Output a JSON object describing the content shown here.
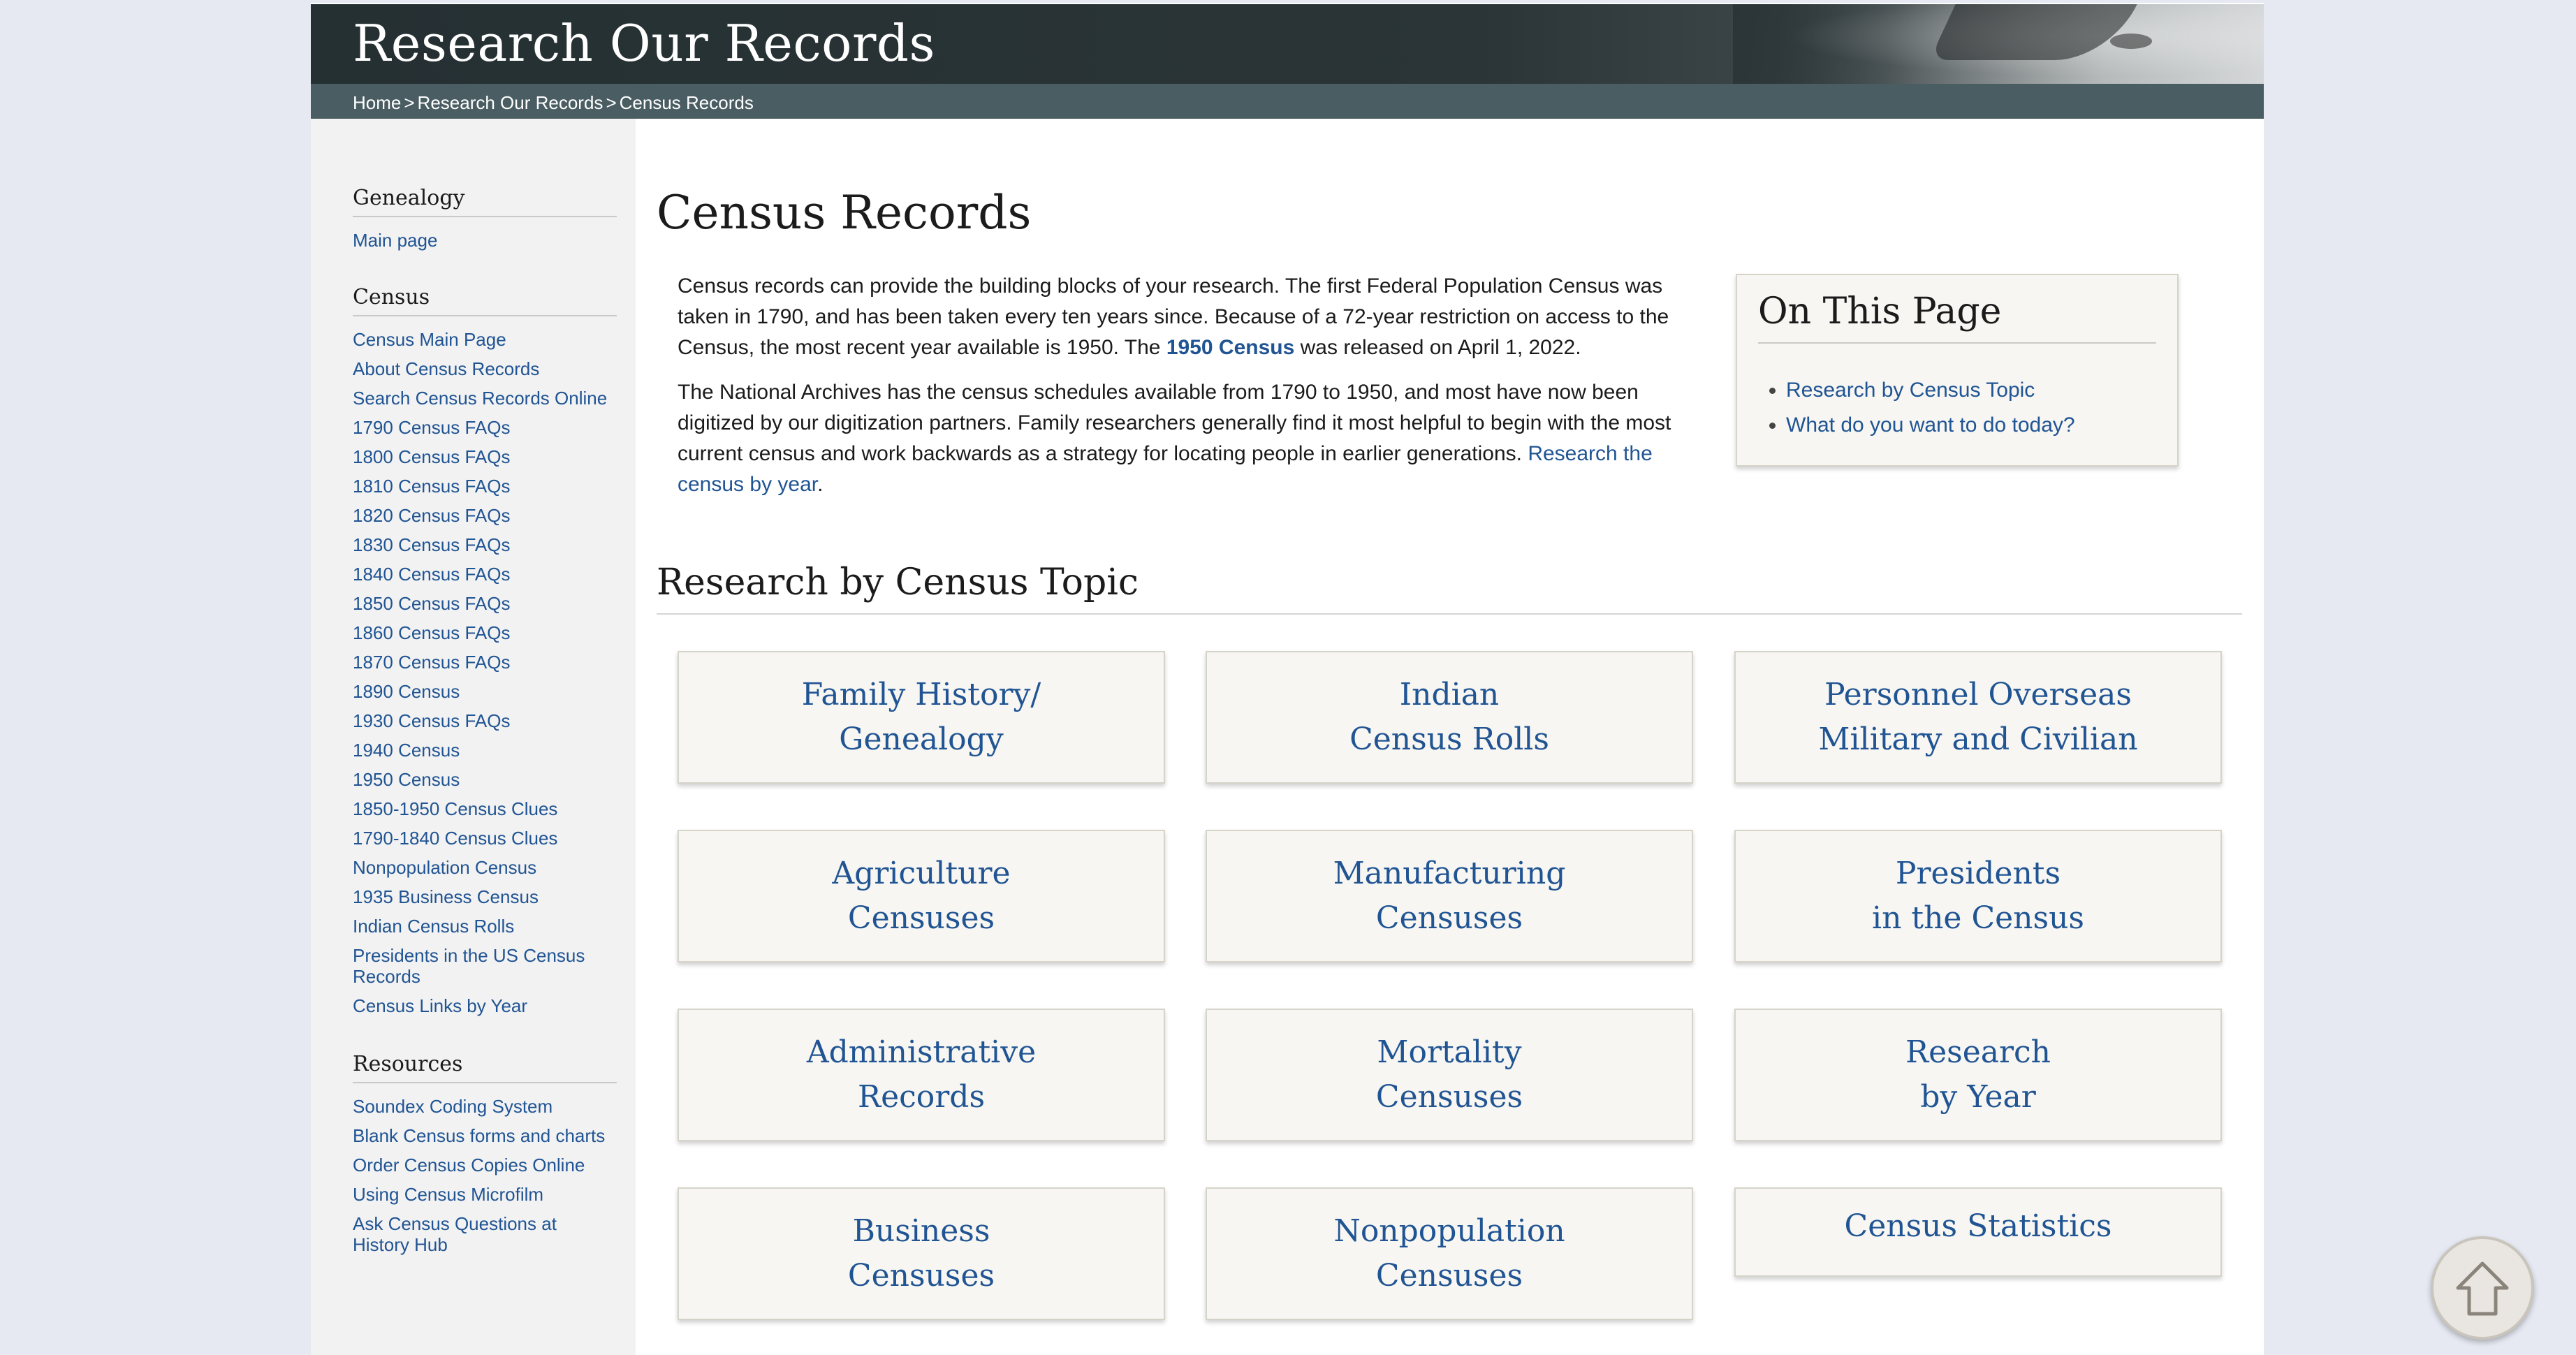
{
  "header": {
    "title": "Research Our Records",
    "breadcrumb": [
      "Home",
      "Research Our Records",
      "Census Records"
    ],
    "breadcrumb_separator": ">"
  },
  "sidebar": {
    "groups": [
      {
        "heading": "Genealogy",
        "items": [
          "Main page"
        ]
      },
      {
        "heading": "Census",
        "items": [
          "Census Main Page",
          "About Census Records",
          "Search Census Records Online",
          "1790 Census FAQs",
          "1800 Census FAQs",
          "1810 Census FAQs",
          "1820 Census FAQs",
          "1830 Census FAQs",
          "1840 Census FAQs",
          "1850 Census FAQs",
          "1860 Census FAQs",
          "1870 Census FAQs",
          "1890 Census",
          "1930 Census FAQs",
          "1940 Census",
          "1950 Census",
          "1850-1950 Census Clues",
          "1790-1840 Census Clues",
          "Nonpopulation Census",
          "1935 Business Census",
          "Indian Census Rolls",
          "Presidents in the US Census Records",
          "Census Links by Year"
        ]
      },
      {
        "heading": "Resources",
        "items": [
          "Soundex Coding System",
          "Blank Census forms and charts",
          "Order Census Copies Online",
          "Using Census Microfilm",
          "Ask Census Questions at History Hub"
        ]
      }
    ]
  },
  "main": {
    "title": "Census Records",
    "intro_p1_a": "Census records can provide the building blocks of your research.  The first Federal Population Census was taken in 1790, and has been taken every ten years since.  Because of a 72-year restriction on access to the Census, the most recent year available is 1950. The ",
    "intro_p1_link": "1950 Census",
    "intro_p1_b": " was released on April 1, 2022.",
    "intro_p2_a": "The National Archives has the census schedules available from 1790 to 1950, and most have now been digitized by our digitization partners. Family researchers generally find it most helpful to begin with the most current census and work backwards as a strategy for locating people in earlier generations. ",
    "intro_p2_link": "Research the census by year",
    "intro_p2_b": ".",
    "on_this_page": {
      "title": "On This Page",
      "links": [
        "Research by Census Topic",
        "What do you want to do today?"
      ]
    },
    "section_title": "Research by Census Topic",
    "cards": [
      {
        "line1": "Family History/",
        "line2": "Genealogy"
      },
      {
        "line1": "Indian",
        "line2": "Census Rolls"
      },
      {
        "line1": "Personnel Overseas",
        "line2": "Military and Civilian"
      },
      {
        "line1": "Agriculture",
        "line2": "Censuses"
      },
      {
        "line1": "Manufacturing",
        "line2": "Censuses"
      },
      {
        "line1": "Presidents",
        "line2": "in the Census"
      },
      {
        "line1": "Administrative",
        "line2": "Records"
      },
      {
        "line1": "Mortality",
        "line2": "Censuses"
      },
      {
        "line1": "Research",
        "line2": "by Year"
      },
      {
        "line1": "Business",
        "line2": "Censuses"
      },
      {
        "line1": "Nonpopulation",
        "line2": "Censuses"
      },
      {
        "line1": "Census Statistics",
        "line2": ""
      }
    ]
  },
  "icons": {
    "scroll_top": "arrow-up-icon"
  },
  "colors": {
    "link": "#205493",
    "header_bg": "#2b3537",
    "breadcrumb_bg": "#4a5d63"
  }
}
